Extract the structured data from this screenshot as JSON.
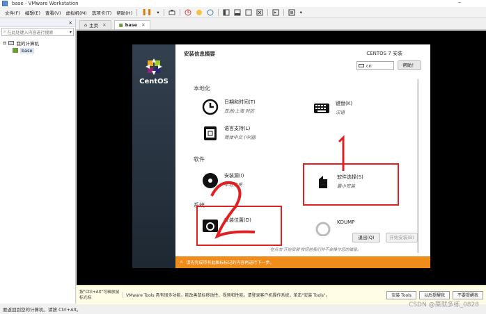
{
  "window": {
    "title": "base - VMware Workstation",
    "minimize": "–"
  },
  "menu": {
    "items": [
      "文件(F)",
      "编辑(E)",
      "查看(V)",
      "虚拟机(M)",
      "选项卡(T)",
      "帮助(H)"
    ]
  },
  "library": {
    "search_placeholder": "在此处键入内容进行搜索",
    "my_computer": "我的计算机",
    "vm_name": "base"
  },
  "tabs": [
    {
      "label": "主页"
    },
    {
      "label": "base"
    }
  ],
  "installer": {
    "logo_text": "CentOS",
    "title": "安装信息摘要",
    "version": "CENTOS 7 安装",
    "keyboard_layout": "cn",
    "help_button": "帮助！",
    "sections": {
      "localization": "本地化",
      "software": "软件",
      "system": "系统"
    },
    "items": {
      "datetime": {
        "title": "日期和时间(T)",
        "status": "亚洲/上海 时区"
      },
      "keyboard": {
        "title": "键盘(K)",
        "status": "汉语"
      },
      "language": {
        "title": "语言支持(L)",
        "status": "简体中文 (中国)"
      },
      "source": {
        "title": "安装源(I)",
        "status": "本地介质"
      },
      "software_selection": {
        "title": "软件选择(S)",
        "status": "最小安装"
      },
      "destination": {
        "title": "安装位置(D)"
      },
      "kdump": {
        "title": "KDUMP"
      }
    },
    "quit_button": "退出(Q)",
    "begin_button": "开始安装(B)",
    "note": "在点击'开始安装'按钮前我们并不会操作您的磁盘。",
    "warning": "请先完成带有此图标标记的内容再进行下一步。"
  },
  "annotations": {
    "one": "1",
    "two": "2"
  },
  "status_bar": {
    "hint": "按\"Ctrl+Alt\"可释放鼠标光标",
    "message": "VMware Tools 具有很多功能，能改善鼠标移动性、视频和性能。请登录客户机操作系统，单击\"安装 Tools\"。",
    "install_tools": "安装 Tools",
    "remind_later": "以后提醒我",
    "never_remind": "不要提醒我"
  },
  "bottom": {
    "text": "要返回到您的计算机，请按 Ctrl+Alt。"
  },
  "watermark": "CSDN @菜就多练_0828",
  "colors": {
    "warning": "#f08c1a",
    "annotation": "#e02020",
    "centos_sidebar": "#2a3441"
  }
}
